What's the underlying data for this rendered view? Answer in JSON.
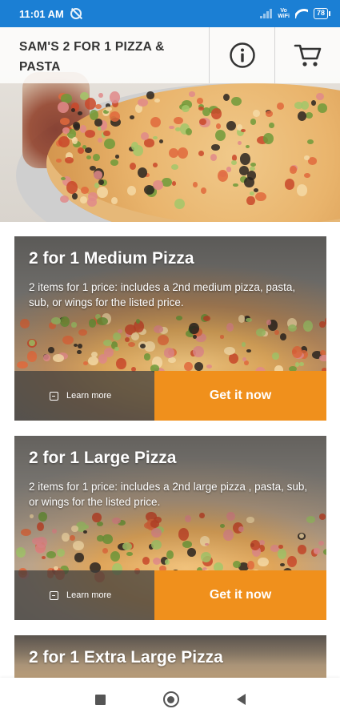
{
  "status_bar": {
    "time": "11:01 AM",
    "network_label": "Vo\nWiFi",
    "battery": "78",
    "icons": [
      "alarm-off-icon",
      "signal-icon",
      "vowifi-icon",
      "wifi-icon",
      "battery-icon"
    ]
  },
  "header": {
    "title": "SAM'S 2 FOR 1 PIZZA & PASTA",
    "info_icon": "info-icon",
    "cart_icon": "cart-icon"
  },
  "deals": [
    {
      "title": "2 for 1 Medium Pizza",
      "description": "2 items for 1 price: includes a 2nd medium pizza, pasta, sub, or wings for the listed price.",
      "learn_more": "Learn more",
      "cta": "Get it now"
    },
    {
      "title": "2 for 1 Large Pizza",
      "description": "2 items for 1 price: includes a 2nd large pizza , pasta, sub, or wings for the listed price.",
      "learn_more": "Learn more",
      "cta": "Get it now"
    },
    {
      "title": "2 for 1 Extra Large Pizza"
    }
  ],
  "nav_bar": {
    "icons": [
      "recents-icon",
      "home-icon",
      "back-icon"
    ]
  },
  "colors": {
    "status_bar": "#1b7fd4",
    "accent": "#f0901c",
    "header_text": "#333333"
  }
}
